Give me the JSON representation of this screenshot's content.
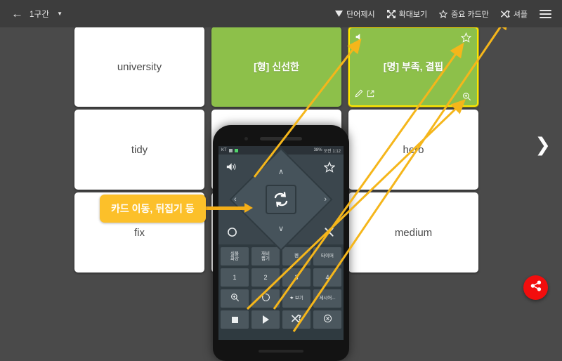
{
  "topbar": {
    "back_icon": "arrow-left-icon",
    "section_label": "1구간",
    "section_caret": "▼",
    "actions": [
      {
        "icon": "filter-triangle-icon",
        "label": "단어제시"
      },
      {
        "icon": "expand-icon",
        "label": "확대보기"
      },
      {
        "icon": "star-outline-icon",
        "label": "중요 카드만"
      },
      {
        "icon": "shuffle-icon",
        "label": "셔플"
      }
    ],
    "menu_icon": "hamburger-menu-icon"
  },
  "colors": {
    "background": "#4a4a4a",
    "topbar": "#3d3d3d",
    "card_white": "#ffffff",
    "card_green": "#8dc04a",
    "selected_border": "#ffe600",
    "tooltip": "#fcc02a",
    "arrow": "#f5b61b",
    "fab": "#f20d0d",
    "phone_body": "#131313",
    "phone_screen": "#2f3a40"
  },
  "cards": [
    {
      "text": "university",
      "kind": "white",
      "selected": false
    },
    {
      "text": "[형] 신선한",
      "kind": "green",
      "selected": false
    },
    {
      "text": "[명] 부족, 결핍",
      "kind": "green",
      "selected": true
    },
    {
      "text": "tidy",
      "kind": "white",
      "selected": false
    },
    {
      "text": "",
      "kind": "white",
      "selected": false
    },
    {
      "text": "hero",
      "kind": "white",
      "selected": false
    },
    {
      "text": "fix",
      "kind": "white",
      "selected": false
    },
    {
      "text": "",
      "kind": "white",
      "selected": false
    },
    {
      "text": "medium",
      "kind": "white",
      "selected": false
    }
  ],
  "selected_card_icons": {
    "speaker": "speaker-icon",
    "star": "star-outline-icon",
    "edit": "pencil-icon",
    "open_external": "external-link-icon",
    "zoom": "magnifier-plus-icon"
  },
  "pager": {
    "next_icon": "chevron-right-icon"
  },
  "tooltip": {
    "text": "카드 이동, 뒤집기 등"
  },
  "fab": {
    "icon": "share-icon"
  },
  "phone": {
    "status_bar": {
      "carrier": "KT",
      "battery": "38%",
      "time": "오전 1:12"
    },
    "dpad": {
      "top_left": "speaker-icon",
      "top_right": "star-outline-icon",
      "bottom_left": "circle-icon",
      "bottom_right": "close-x-icon",
      "up": "chevron-up-icon",
      "down": "chevron-down-icon",
      "left": "chevron-left-icon",
      "right": "chevron-right-icon",
      "center": "flip-repeat-icon"
    },
    "keys": [
      [
        {
          "label": "실물\n화상",
          "type": "text"
        },
        {
          "label": "재비\n뽑기",
          "type": "text"
        },
        {
          "label": "펜",
          "type": "text"
        },
        {
          "label": "타이머",
          "type": "text"
        }
      ],
      [
        {
          "label": "1",
          "type": "num"
        },
        {
          "label": "2",
          "type": "num"
        },
        {
          "label": "3",
          "type": "num"
        },
        {
          "label": "4",
          "type": "num"
        }
      ],
      [
        {
          "label": "magnifier-plus-icon",
          "type": "icon"
        },
        {
          "label": "rotate-icon",
          "type": "icon"
        },
        {
          "label": "★ 보기",
          "type": "text"
        },
        {
          "label": "제시어...",
          "type": "text"
        }
      ],
      [
        {
          "label": "stop-square-icon",
          "type": "icon"
        },
        {
          "label": "play-triangle-icon",
          "type": "icon"
        },
        {
          "label": "shuffle-icon",
          "type": "icon"
        },
        {
          "label": "circle-x-icon",
          "type": "icon"
        }
      ]
    ]
  },
  "annotation_arrows": [
    {
      "from": "phone-speaker-key",
      "to": "card-speaker-icon"
    },
    {
      "from": "phone-star-key",
      "to": "card-star-icon"
    },
    {
      "from": "phone-shuffle-key",
      "to": "topbar-shuffle-action"
    },
    {
      "from": "phone-zoom-key",
      "to": "card-zoom-icon"
    },
    {
      "from": "tooltip",
      "to": "phone-dpad-center"
    }
  ]
}
